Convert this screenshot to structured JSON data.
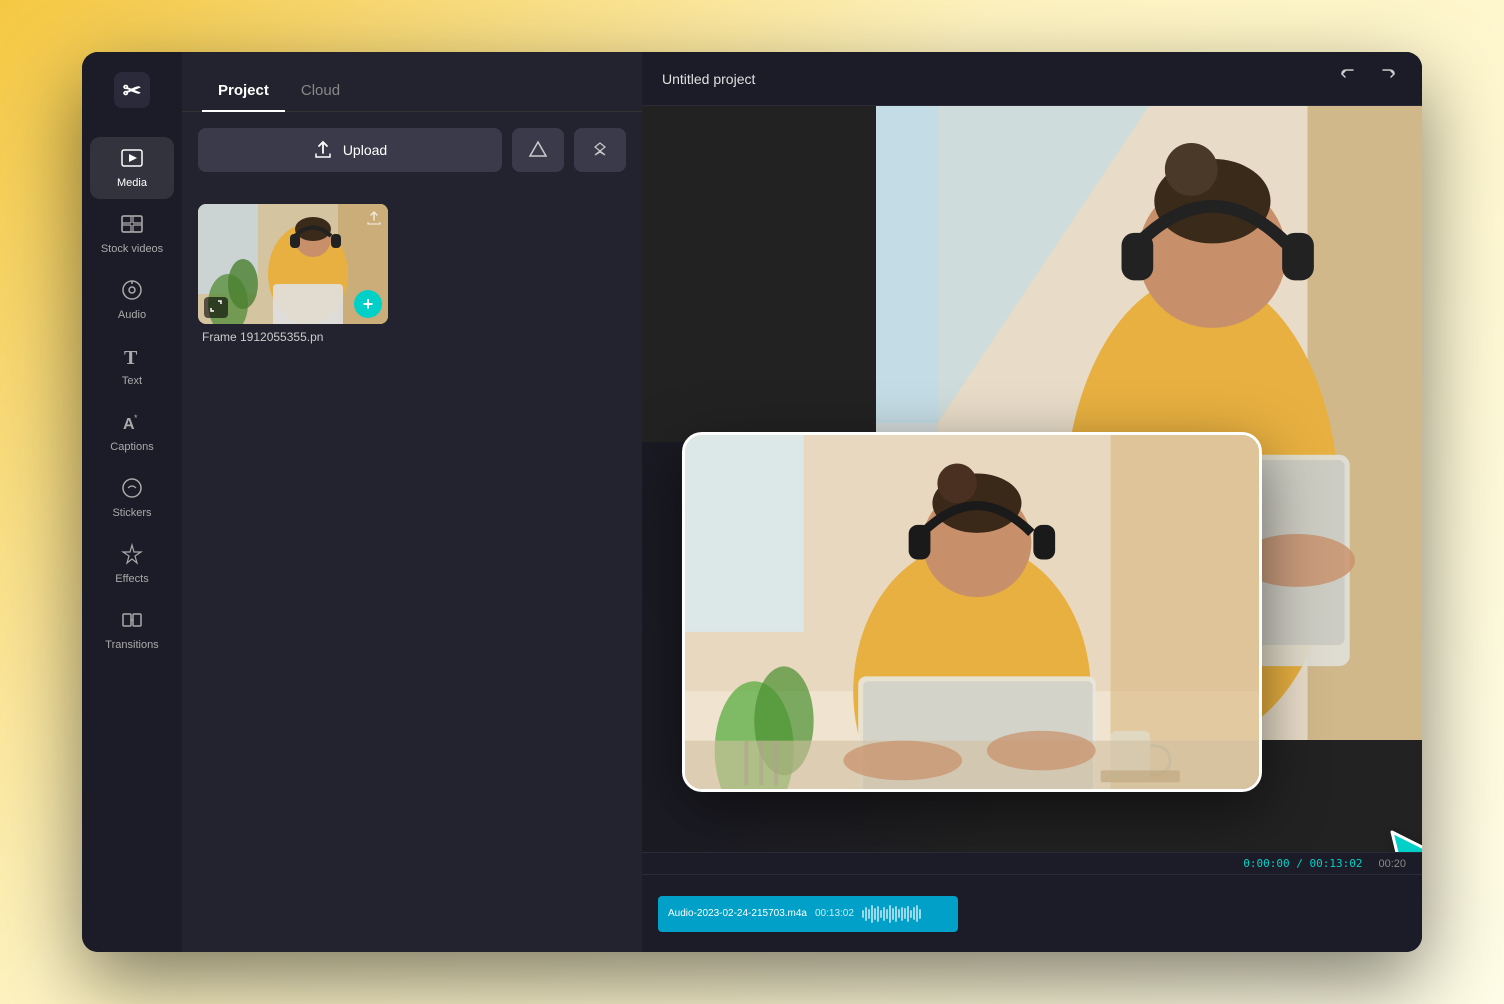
{
  "app": {
    "logo_symbol": "✂",
    "project_title": "Untitled project"
  },
  "sidebar": {
    "items": [
      {
        "id": "media",
        "label": "Media",
        "icon": "▶",
        "active": true
      },
      {
        "id": "stock-videos",
        "label": "Stock videos",
        "icon": "⊞"
      },
      {
        "id": "audio",
        "label": "Audio",
        "icon": "◎"
      },
      {
        "id": "text",
        "label": "Text",
        "icon": "T"
      },
      {
        "id": "captions",
        "label": "Captions",
        "icon": "A*"
      },
      {
        "id": "stickers",
        "label": "Stickers",
        "icon": "○"
      },
      {
        "id": "effects",
        "label": "Effects",
        "icon": "✦"
      },
      {
        "id": "transitions",
        "label": "Transitions",
        "icon": "⊠"
      }
    ]
  },
  "media_panel": {
    "tabs": [
      {
        "id": "project",
        "label": "Project",
        "active": true
      },
      {
        "id": "cloud",
        "label": "Cloud",
        "active": false
      }
    ],
    "upload_button": "Upload",
    "google_drive_icon": "▲",
    "dropbox_icon": "◆",
    "media_items": [
      {
        "filename": "Frame 1912055355.pn",
        "type": "image"
      }
    ]
  },
  "topbar": {
    "undo_icon": "↩",
    "redo_icon": "↪"
  },
  "timeline": {
    "time_display": "0:00:00 / 00:13:02",
    "marker": "00:20",
    "audio_clip_label": "Audio-2023-02-24-215703.m4a",
    "audio_clip_duration": "00:13:02"
  },
  "colors": {
    "accent_teal": "#00d0c8",
    "sidebar_bg": "#1c1c28",
    "panel_bg": "#23232f",
    "main_bg": "#1a1a24"
  }
}
